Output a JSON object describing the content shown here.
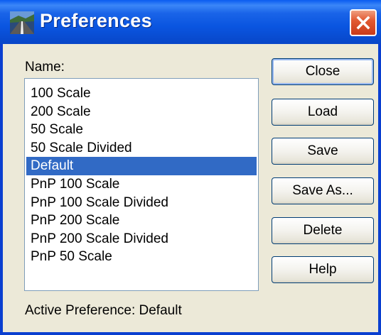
{
  "window": {
    "title": "Preferences",
    "icon": "roadway-app-icon",
    "close_icon": "close-x-icon"
  },
  "name_label": "Name:",
  "list": {
    "items": [
      "100 Scale",
      "200 Scale",
      "50 Scale",
      "50 Scale Divided",
      "Default",
      "PnP 100 Scale",
      "PnP 100 Scale Divided",
      "PnP 200 Scale",
      "PnP 200 Scale Divided",
      "PnP 50 Scale"
    ],
    "selected": "Default"
  },
  "buttons": {
    "close": "Close",
    "load": "Load",
    "save": "Save",
    "save_as": "Save As...",
    "delete": "Delete",
    "help": "Help"
  },
  "status": {
    "active_preference": "Active Preference: Default"
  },
  "colors": {
    "titlebar": "#0a55e0",
    "selection": "#316ac5",
    "dialog_bg": "#ece9d8",
    "close_button": "#e25a32"
  }
}
